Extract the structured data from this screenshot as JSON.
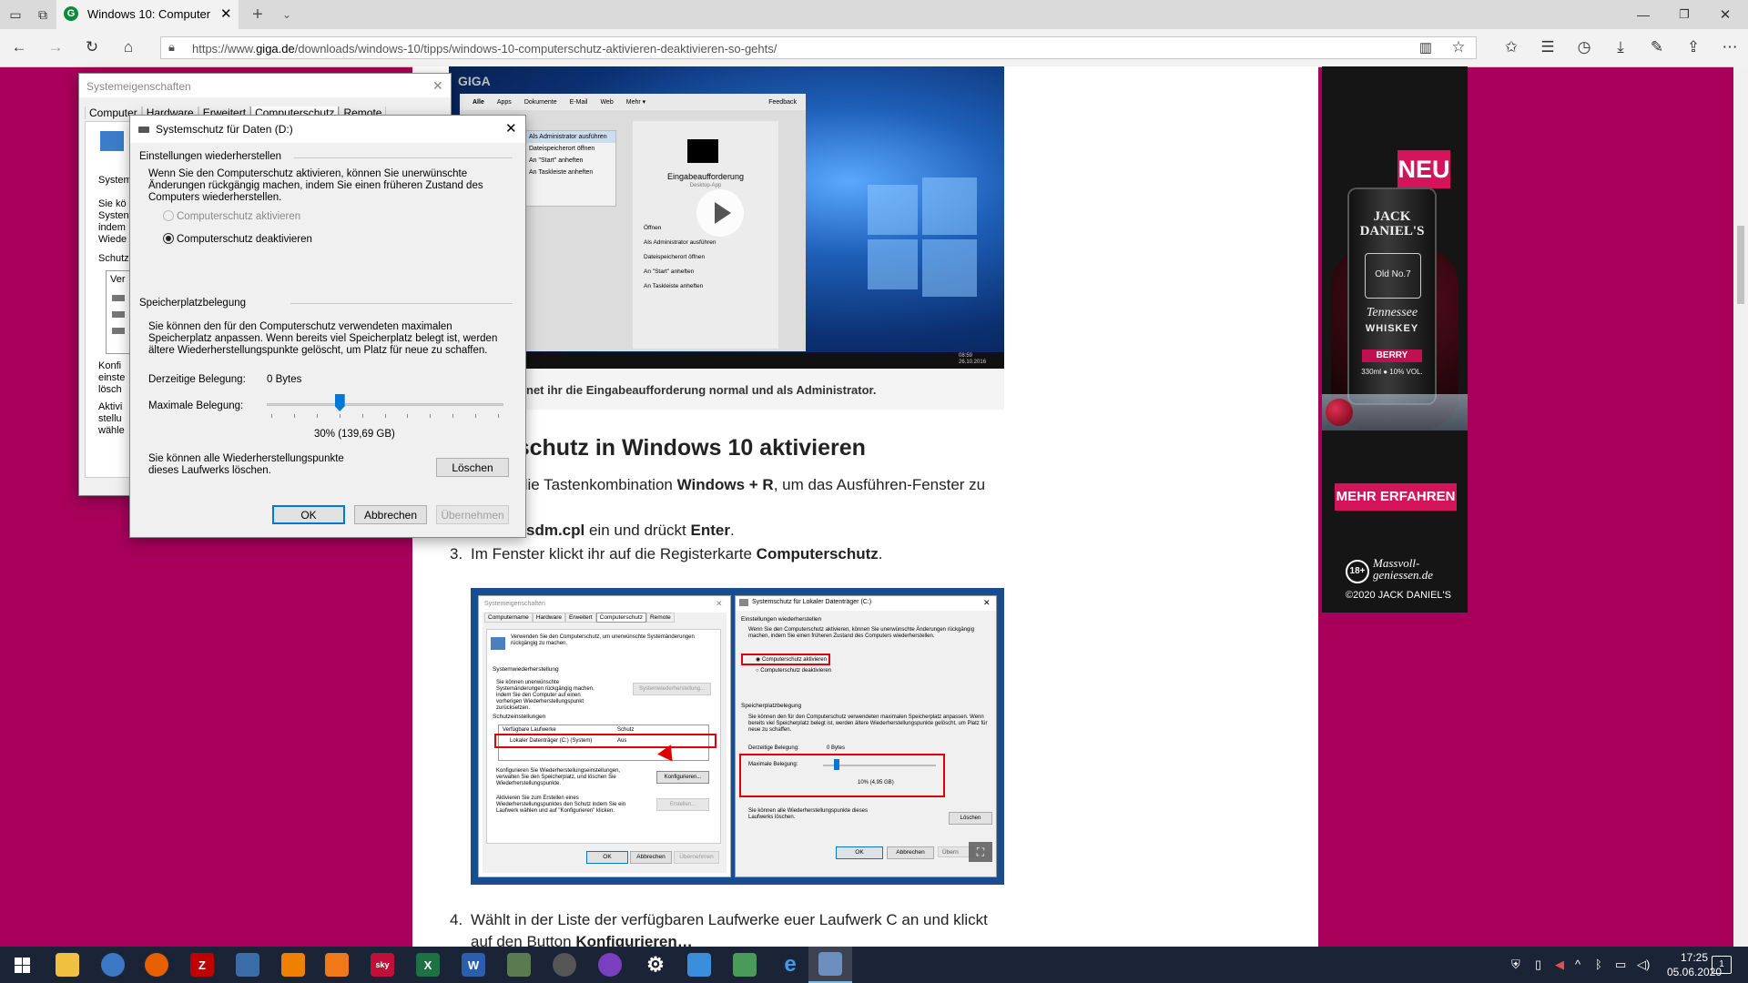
{
  "browser": {
    "tab_title": "Windows 10: Computer",
    "url_prefix": "https://www.",
    "url_domain": "giga.de",
    "url_path": "/downloads/windows-10/tipps/windows-10-computerschutz-aktivieren-deaktivieren-so-gehts/"
  },
  "article": {
    "caption": "net ihr die Eingabeaufforderung normal und als Administrator.",
    "heading": "rschutz in Windows 10 aktivieren",
    "step1_pre": "die Tastenkombination ",
    "step1_bold": "Windows + R",
    "step1_post": ", um das Ausführen-Fenster zu",
    "step2_bold": "sdm.cpl",
    "step2_mid": " ein und drückt ",
    "step2_bold2": "Enter",
    "step2_end": ".",
    "step3_num": "3.",
    "step3_pre": "Im Fenster klickt ihr auf die Registerkarte ",
    "step3_bold": "Computerschutz",
    "step3_end": ".",
    "step4_num": "4.",
    "step4_line1": "Wählt in der Liste der verfügbaren Laufwerke euer Laufwerk C an und klickt",
    "step4_line2_pre": "auf den Button ",
    "step4_line2_bold": "Konfigurieren…"
  },
  "video": {
    "search_tabs": [
      "Alle",
      "Apps",
      "Dokumente",
      "E-Mail",
      "Web",
      "Mehr ▾"
    ],
    "feedback": "Feedback",
    "context_items": [
      "Als Administrator ausführen",
      "Dateispeicherort öffnen",
      "An \"Start\" anheften",
      "An Taskleiste anheften"
    ],
    "panel_title": "Eingabeaufforderung",
    "panel_sub": "Desktop-App",
    "panel_items": [
      "Öffnen",
      "Als Administrator ausführen",
      "Dateispeicherort öffnen",
      "An \"Start\" anheften",
      "An Taskleiste anheften"
    ],
    "clock": "08:59",
    "date": "26.10.2016",
    "logo": "GIGA"
  },
  "ad": {
    "badge": "NEU",
    "brand": "JACK DANIEL'S",
    "can_lines": [
      "Old No.7",
      "Tennessee",
      "WHISKEY",
      "BERRY",
      "330ml ● 10% VOL."
    ],
    "cta": "MEHR ERFAHREN",
    "age": "18+",
    "slogan1": "Massvoll-",
    "slogan2": "geniessen.de",
    "copyright": "©2020 JACK DANIEL'S"
  },
  "sysprops": {
    "title": "Systemeigenschaften",
    "tabs": [
      "Computer",
      "Hardware",
      "Erweitert",
      "Computerschutz",
      "Remote"
    ],
    "left_fragments": [
      "System",
      "Sie kö",
      "Systen",
      "indem",
      "Wiede",
      "Schutz",
      "Ver",
      "Konfi",
      "einste",
      "lösch",
      "Aktivi",
      "stellu",
      "wähle"
    ]
  },
  "dialog": {
    "title": "Systemschutz für Daten (D:)",
    "restore_header": "Einstellungen wiederherstellen",
    "restore_text": "Wenn Sie den Computerschutz aktivieren, können Sie unerwünschte Änderungen rückgängig machen, indem Sie einen früheren Zustand des Computers wiederherstellen.",
    "radio_on": "Computerschutz aktivieren",
    "radio_off": "Computerschutz deaktivieren",
    "space_header": "Speicherplatzbelegung",
    "space_text": "Sie können den für den Computerschutz verwendeten maximalen Speicherplatz anpassen. Wenn bereits viel Speicherplatz belegt ist, werden ältere Wiederherstellungspunkte gelöscht, um Platz für neue zu schaffen.",
    "current_label": "Derzeitige Belegung:",
    "current_value": "0 Bytes",
    "max_label": "Maximale Belegung:",
    "slider_fraction": 0.3,
    "slider_value": "30% (139,69 GB)",
    "delete_text": "Sie können alle Wiederherstellungspunkte dieses Laufwerks löschen.",
    "delete_btn": "Löschen",
    "ok": "OK",
    "cancel": "Abbrechen",
    "apply": "Übernehmen"
  },
  "shot_left": {
    "title": "Systemeigenschaften",
    "tabs": [
      "Computername",
      "Hardware",
      "Erweitert",
      "Computerschutz",
      "Remote"
    ],
    "intro": "Verwenden Sie den Computerschutz, um unerwünschte Systemänderungen rückgängig zu machen.",
    "restore_header": "Systemwiederherstellung",
    "restore_text": "Sie können unerwünschte Systemänderungen rückgängig machen, indem Sie den Computer auf einen vorherigen Wiederherstellungspunkt zurücksetzen.",
    "restore_btn": "Systemwiederherstellung...",
    "protect_header": "Schutzeinstellungen",
    "col_drives": "Verfügbare Laufwerke",
    "col_protect": "Schutz",
    "drive": "Lokaler Datenträger (C:) (System)",
    "drive_state": "Aus",
    "config_text": "Konfigurieren Sie Wiederherstellungseinstellungen, verwalten Sie den Speicherplatz, und löschen Sie Wiederherstellungspunkte.",
    "config_btn": "Konfigurieren...",
    "create_text": "Aktivieren Sie zum Erstellen eines Wiederherstellungspunktes den Schutz indem Sie ein Laufwerk wählen und auf \"Konfigurieren\" klicken.",
    "create_btn": "Erstellen...",
    "ok": "OK",
    "cancel": "Abbrechen",
    "apply": "Übernehmen"
  },
  "shot_right": {
    "title": "Systemschutz für Lokaler Datenträger (C:)",
    "restore_header": "Einstellungen wiederherstellen",
    "restore_text": "Wenn Sie den Computerschutz aktivieren, können Sie unerwünschte Änderungen rückgängig machen, indem Sie einen früheren Zustand des Computers wiederherstellen.",
    "radio_on": "Computerschutz aktivieren",
    "radio_off": "Computerschutz deaktivieren",
    "space_header": "Speicherplatzbelegung",
    "space_text": "Sie können den für den Computerschutz verwendeten maximalen Speicherplatz anpassen. Wenn bereits viel Speicherplatz belegt ist, werden ältere Wiederherstellungspunkte gelöscht, um Platz für neue zu schaffen.",
    "current_label": "Derzeitige Belegung:",
    "current_value": "0 Bytes",
    "max_label": "Maximale Belegung:",
    "slider_fraction": 0.1,
    "slider_value": "10% (4,95 GB)",
    "delete_text": "Sie können alle Wiederherstellungspunkte dieses Laufwerks löschen.",
    "delete_btn": "Löschen",
    "ok": "OK",
    "cancel": "Abbrechen",
    "apply": "Übern"
  },
  "taskbar": {
    "time": "17:25",
    "date": "05.06.2020",
    "notif_count": "1"
  },
  "colors": {
    "magenta": "#a8005a",
    "accent": "#0078d7",
    "highlight_red": "#e00000",
    "ad_pink": "#d4145a"
  }
}
